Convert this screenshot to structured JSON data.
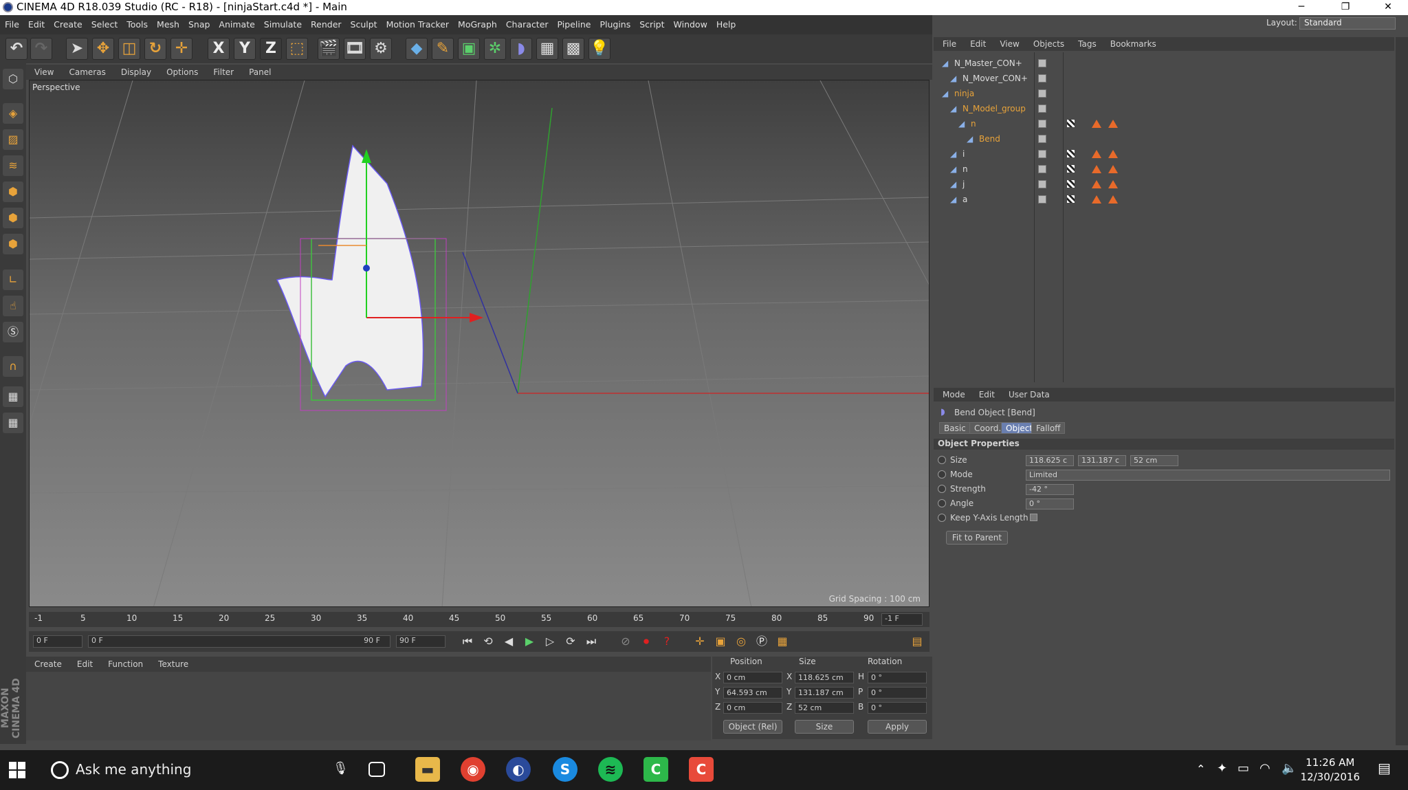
{
  "window": {
    "title": "CINEMA 4D R18.039 Studio (RC - R18) - [ninjaStart.c4d *] - Main",
    "minimize": "─",
    "restore": "❐",
    "close": "✕"
  },
  "menubar": {
    "items": [
      "File",
      "Edit",
      "Create",
      "Select",
      "Tools",
      "Mesh",
      "Snap",
      "Animate",
      "Simulate",
      "Render",
      "Sculpt",
      "Motion Tracker",
      "MoGraph",
      "Character",
      "Pipeline",
      "Plugins",
      "Script",
      "Window",
      "Help"
    ],
    "layout_label": "Layout:",
    "layout_value": "Standard"
  },
  "toolbar": {
    "axis_x": "X",
    "axis_y": "Y",
    "axis_z": "Z"
  },
  "viewport": {
    "menu": [
      "View",
      "Cameras",
      "Display",
      "Options",
      "Filter",
      "Panel"
    ],
    "label": "Perspective",
    "grid_spacing": "Grid Spacing : 100 cm"
  },
  "timeline": {
    "ticks": [
      "-1",
      "5",
      "10",
      "15",
      "20",
      "25",
      "30",
      "35",
      "40",
      "45",
      "50",
      "55",
      "60",
      "65",
      "70",
      "75",
      "80",
      "85",
      "90"
    ],
    "current": "-1 F",
    "start": "0 F",
    "range_start": "0 F",
    "range_end": "90 F",
    "end": "90 F"
  },
  "material": {
    "menu": [
      "Create",
      "Edit",
      "Function",
      "Texture"
    ]
  },
  "coords": {
    "headers": [
      "Position",
      "Size",
      "Rotation"
    ],
    "rows": [
      {
        "axis": "X",
        "pos": "0 cm",
        "saxis": "X",
        "size": "118.625 cm",
        "raxis": "H",
        "rot": "0 °"
      },
      {
        "axis": "Y",
        "pos": "64.593 cm",
        "saxis": "Y",
        "size": "131.187 cm",
        "raxis": "P",
        "rot": "0 °"
      },
      {
        "axis": "Z",
        "pos": "0 cm",
        "saxis": "Z",
        "size": "52 cm",
        "raxis": "B",
        "rot": "0 °"
      }
    ],
    "mode": "Object (Rel)",
    "size_mode": "Size",
    "apply": "Apply"
  },
  "objects": {
    "menu": [
      "File",
      "Edit",
      "View",
      "Objects",
      "Tags",
      "Bookmarks"
    ],
    "tree": [
      "N_Master_CON+",
      "N_Mover_CON+",
      "ninja",
      "N_Model_group",
      "n",
      "Bend",
      "i",
      "n",
      "j",
      "a"
    ]
  },
  "attributes": {
    "menu": [
      "Mode",
      "Edit",
      "User Data"
    ],
    "object_title": "Bend Object [Bend]",
    "tabs": [
      "Basic",
      "Coord.",
      "Object",
      "Falloff"
    ],
    "section": "Object Properties",
    "size_label": "Size",
    "size": [
      "118.625 c",
      "131.187 c",
      "52 cm"
    ],
    "mode_label": "Mode",
    "mode": "Limited",
    "strength_label": "Strength",
    "strength": "-42 °",
    "angle_label": "Angle",
    "angle": "0 °",
    "keepy_label": "Keep Y-Axis Length",
    "fit_button": "Fit to Parent"
  },
  "taskbar": {
    "search": "Ask me anything",
    "time": "11:26 AM",
    "date": "12/30/2016"
  },
  "colors": {
    "accent": "#e86a2a",
    "selected_tab": "#6a7fb0"
  }
}
